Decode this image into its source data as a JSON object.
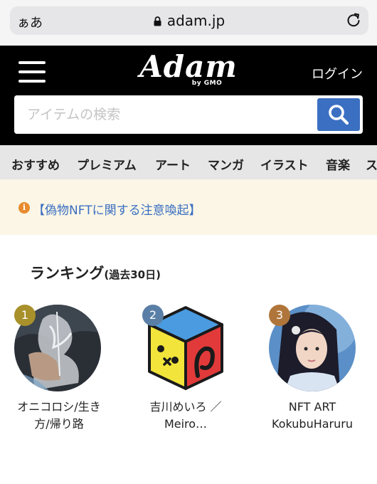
{
  "browser": {
    "text_size_label": "ぁあ",
    "url": "adam.jp",
    "icons": [
      "lock-icon",
      "reload-icon"
    ]
  },
  "header": {
    "logo_text": "Adam",
    "logo_sub": "by GMO",
    "login_label": "ログイン",
    "search_placeholder": "アイテムの検索",
    "icons": [
      "hamburger-menu-icon",
      "search-icon"
    ],
    "colors": {
      "background": "#000000",
      "search_button": "#3b6fc2"
    }
  },
  "categories": [
    "おすすめ",
    "プレミアム",
    "アート",
    "マンガ",
    "イラスト",
    "音楽",
    "ス"
  ],
  "notice": {
    "icon": "info-icon",
    "text": "【偽物NFTに関する注意喚起】",
    "colors": {
      "background": "#fbf6e6",
      "link": "#3b6fc2",
      "icon": "#e88b2e"
    }
  },
  "ranking": {
    "title": "ランキング",
    "period": "(過去30日)",
    "items": [
      {
        "rank": "1",
        "name_line1": "オニコロシ/生き",
        "name_line2": "方/帰り路",
        "badge_color": "#a8902a"
      },
      {
        "rank": "2",
        "name_line1": "吉川めいろ ／",
        "name_line2": "Meiro…",
        "badge_color": "#5a7fa6"
      },
      {
        "rank": "3",
        "name_line1": "NFT ART",
        "name_line2": "KokubuHaruru",
        "badge_color": "#b0753a"
      }
    ]
  }
}
